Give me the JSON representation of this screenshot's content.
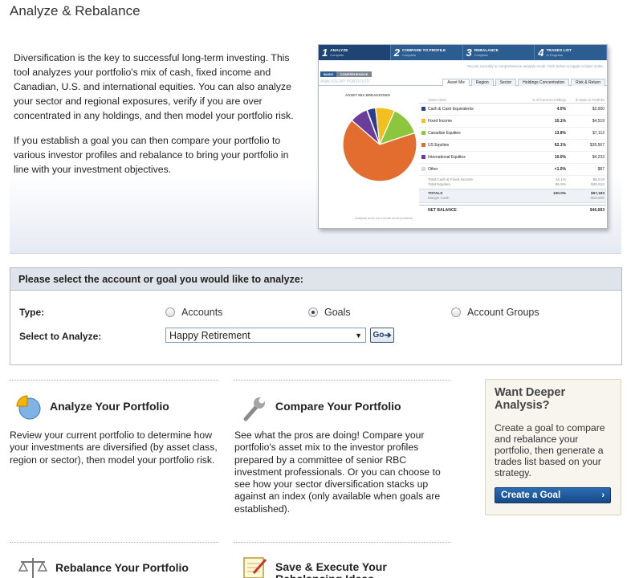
{
  "page": {
    "title": "Analyze & Rebalance"
  },
  "intro": {
    "paragraph1": "Diversification is the key to successful long-term investing. This tool analyzes your portfolio's mix of cash, fixed income and Canadian, U.S. and international equities. You can also analyze your sector and regional exposures, verify if you are over concentrated in any holdings, and then model your portfolio risk.",
    "paragraph2": "If you establish a goal you can then compare your portfolio to various investor profiles and rebalance to bring your portfolio in line with your investment objectives."
  },
  "preview": {
    "steps": [
      {
        "num": "1",
        "label": "ANALYZE",
        "status": "Complete"
      },
      {
        "num": "2",
        "label": "COMPARE TO PROFILE",
        "status": "Complete"
      },
      {
        "num": "3",
        "label": "REBALANCE",
        "status": "Complete"
      },
      {
        "num": "4",
        "label": "TRADES LIST",
        "status": "In Progress"
      }
    ],
    "note": "You are currently in comprehensive analysis mode. Click below to toggle to basic mode.",
    "modes": [
      "BASIC",
      "COMPREHENSIVE"
    ],
    "section_label": "ANALYZE MY PORTFOLIO",
    "tabs": [
      "Asset Mix",
      "Region",
      "Sector",
      "Holdings Concentration",
      "Risk & Return"
    ],
    "chart_title": "ASSET MIX BREAKDOWN",
    "footnote": "Analysis does not include short positions",
    "table_headers": {
      "asset_class": "Asset Class",
      "pct": "% of Current Holdings",
      "value": "$ Value in Portfolio"
    },
    "rows": [
      {
        "name": "Cash & Cash Equivalents",
        "pct": "4.0%",
        "value": "$2,000",
        "color": "#2d3c8c"
      },
      {
        "name": "Fixed Income",
        "pct": "10.1%",
        "value": "$4,519",
        "color": "#f2c01e"
      },
      {
        "name": "Canadian Equities",
        "pct": "13.8%",
        "value": "$7,112",
        "color": "#8cc63f"
      },
      {
        "name": "US Equities",
        "pct": "62.1%",
        "value": "$35,567",
        "color": "#e36c2f"
      },
      {
        "name": "International Equities",
        "pct": "10.0%",
        "value": "$4,233",
        "color": "#6a3d9a"
      },
      {
        "name": "Other",
        "pct": "<1.0%",
        "value": "$87",
        "color": "#d9d9d9"
      }
    ],
    "totals": [
      {
        "name": "Total Cash & Fixed Income",
        "pct": "14.1%",
        "value": "$6,519"
      },
      {
        "name": "Total Equities",
        "pct": "85.9%",
        "value": "$46,912"
      }
    ],
    "sub": {
      "name": "TOTALS",
      "sub_name": "Margin Cash",
      "pct": "100.0%",
      "value": "$57,183",
      "sub_value": "-$10,500"
    },
    "net": {
      "name": "NET BALANCE",
      "value": "$46,683"
    }
  },
  "selector": {
    "heading": "Please select the account or goal you would like to analyze:",
    "type_label": "Type:",
    "options": [
      {
        "label": "Accounts",
        "checked": false
      },
      {
        "label": "Goals",
        "checked": true
      },
      {
        "label": "Account Groups",
        "checked": false
      }
    ],
    "select_label": "Select to Analyze:",
    "selected_value": "Happy Retirement",
    "go_label": "Go"
  },
  "features": [
    {
      "title": "Analyze Your Portfolio",
      "icon": "pie-chart-icon",
      "desc": "Review your current portfolio to determine how your investments are diversified (by asset class, region or sector), then model your portfolio risk."
    },
    {
      "title": "Compare Your Portfolio",
      "icon": "wrench-icon",
      "desc": "See what the pros are doing! Compare your portfolio's asset mix to the investor profiles prepared by a committee of senior RBC investment professionals. Or you can choose to see how your sector diversification stacks up against an index (only available when goals are established)."
    },
    {
      "title": "Rebalance Your Portfolio",
      "icon": "scales-icon",
      "desc": ""
    },
    {
      "title": "Save & Execute Your Rebalancing Ideas",
      "icon": "notepad-icon",
      "desc": ""
    }
  ],
  "deeper": {
    "title": "Want Deeper Analysis?",
    "desc": "Create a goal to compare and rebalance your portfolio, then generate a trades list based on your strategy.",
    "button": "Create a Goal"
  }
}
